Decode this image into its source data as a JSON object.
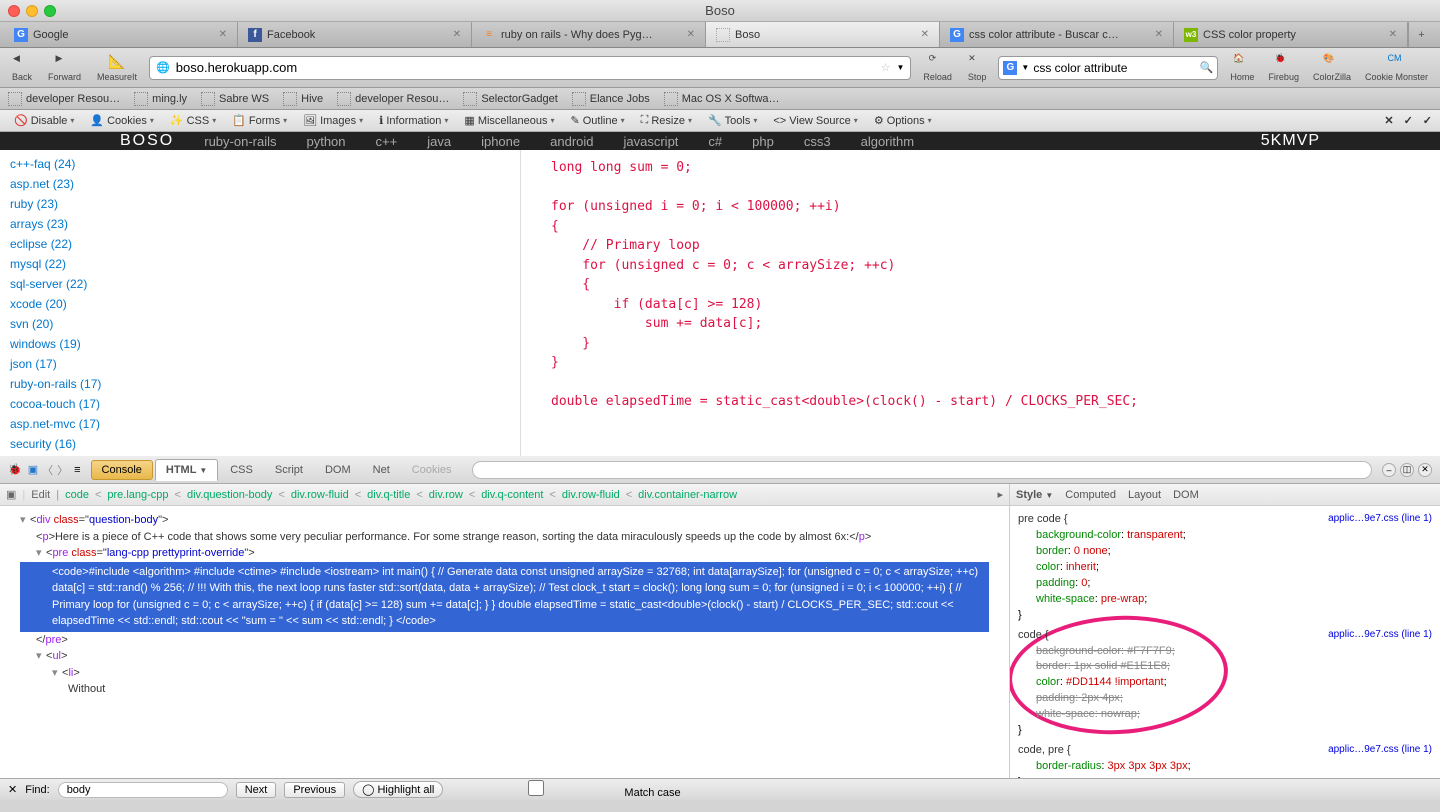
{
  "window": {
    "title": "Boso"
  },
  "tabs": [
    {
      "label": "Google",
      "fav": "G"
    },
    {
      "label": "Facebook",
      "fav": "f"
    },
    {
      "label": "ruby on rails - Why does Pyg…",
      "fav": "≡"
    },
    {
      "label": "Boso",
      "fav": ""
    },
    {
      "label": "css color attribute - Buscar c…",
      "fav": "G"
    },
    {
      "label": "CSS color property",
      "fav": "w3"
    }
  ],
  "active_tab": 3,
  "nav": {
    "back": "Back",
    "forward": "Forward",
    "measureit": "MeasureIt",
    "url": "boso.herokuapp.com",
    "reload": "Reload",
    "stop": "Stop",
    "search_value": "css color attribute",
    "home": "Home",
    "firebug": "Firebug",
    "colorzilla": "ColorZilla",
    "cookiemonster": "Cookie Monster"
  },
  "bookmarks": [
    "developer Resou…",
    "ming.ly",
    "Sabre WS",
    "Hive",
    "developer Resou…",
    "SelectorGadget",
    "Elance Jobs",
    "Mac OS X Softwa…"
  ],
  "devtoolbar": [
    "Disable",
    "Cookies",
    "CSS",
    "Forms",
    "Images",
    "Information",
    "Miscellaneous",
    "Outline",
    "Resize",
    "Tools",
    "View Source",
    "Options"
  ],
  "blackbar": {
    "logo": "BOSO",
    "items": [
      "ruby-on-rails",
      "python",
      "c++",
      "java",
      "iphone",
      "android",
      "javascript",
      "c#",
      "php",
      "css3",
      "algorithm"
    ],
    "brand": "5KMVP"
  },
  "sidebar_links": [
    "c++-faq (24)",
    "asp.net (23)",
    "ruby (23)",
    "arrays (23)",
    "eclipse (22)",
    "mysql (22)",
    "sql-server (22)",
    "xcode (20)",
    "svn (20)",
    "windows (19)",
    "json (17)",
    "ruby-on-rails (17)",
    "cocoa-touch (17)",
    "asp.net-mvc (17)",
    "security (16)"
  ],
  "code_lines": [
    "long long sum = 0;",
    "",
    "for (unsigned i = 0; i < 100000; ++i)",
    "{",
    "    // Primary loop",
    "    for (unsigned c = 0; c < arraySize; ++c)",
    "    {",
    "        if (data[c] >= 128)",
    "            sum += data[c];",
    "    }",
    "}",
    "",
    "double elapsedTime = static_cast<double>(clock() - start) / CLOCKS_PER_SEC;"
  ],
  "firebug": {
    "tabs": [
      "Console",
      "HTML",
      "CSS",
      "Script",
      "DOM",
      "Net",
      "Cookies"
    ],
    "active_tab": "HTML",
    "crumb": [
      "Edit",
      "code",
      "pre.lang-cpp",
      "div.question-body",
      "div.row-fluid",
      "div.q-title",
      "div.row",
      "div.q-content",
      "div.row-fluid",
      "div.container-narrow"
    ],
    "html": {
      "div_open": "<div class=\"question-body\">",
      "p_text": "Here is a piece of C++ code that shows some very peculiar performance. For some strange reason, sorting the data miraculously speeds up the code by almost 6x:",
      "pre_open": "<pre class=\"lang-cpp prettyprint-override\">",
      "code_sel": "<code>#include <algorithm> #include <ctime> #include <iostream> int main() { // Generate data const unsigned arraySize = 32768; int data[arraySize]; for (unsigned c = 0; c < arraySize; ++c) data[c] = std::rand() % 256; // !!! With this, the next loop runs faster std::sort(data, data + arraySize); // Test clock_t start = clock(); long long sum = 0; for (unsigned i = 0; i < 100000; ++i) { // Primary loop for (unsigned c = 0; c < arraySize; ++c) { if (data[c] >= 128) sum += data[c]; } } double elapsedTime = static_cast<double>(clock() - start) / CLOCKS_PER_SEC; std::cout << elapsedTime << std::endl; std::cout << \"sum = \" << sum << std::endl; } </code>",
      "pre_close": "</pre>",
      "ul": "<ul>",
      "li": "<li>",
      "li_text": "Without"
    },
    "style_tabs": [
      "Style",
      "Computed",
      "Layout",
      "DOM"
    ],
    "rules": [
      {
        "sel": "pre code {",
        "src": "applic…9e7.css (line 1)",
        "props": [
          {
            "n": "background-color",
            "v": "transparent",
            "s": false
          },
          {
            "n": "border",
            "v": "0 none",
            "s": false
          },
          {
            "n": "color",
            "v": "inherit",
            "s": false
          },
          {
            "n": "padding",
            "v": "0",
            "s": false
          },
          {
            "n": "white-space",
            "v": "pre-wrap",
            "s": false
          }
        ]
      },
      {
        "sel": "code {",
        "src": "applic…9e7.css (line 1)",
        "props": [
          {
            "n": "background-color",
            "v": "#F7F7F9",
            "s": true
          },
          {
            "n": "border",
            "v": "1px solid #E1E1E8",
            "s": true
          },
          {
            "n": "color",
            "v": "#DD1144 !important",
            "s": false
          },
          {
            "n": "padding",
            "v": "2px 4px",
            "s": true
          },
          {
            "n": "white-space",
            "v": "nowrap",
            "s": true
          }
        ]
      },
      {
        "sel": "code, pre {",
        "src": "applic…9e7.css (line 1)",
        "props": [
          {
            "n": "border-radius",
            "v": "3px 3px 3px 3px",
            "s": false
          }
        ]
      }
    ]
  },
  "findbar": {
    "label": "Find:",
    "value": "body",
    "next": "Next",
    "prev": "Previous",
    "highlight": "Highlight all",
    "matchcase": "Match case",
    "close": "✕"
  }
}
